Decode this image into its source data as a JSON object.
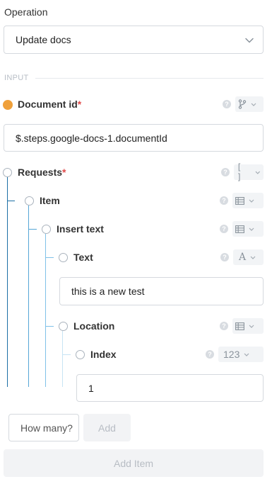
{
  "operation": {
    "label": "Operation",
    "selected": "Update docs"
  },
  "input_section": {
    "label": "INPUT"
  },
  "fields": {
    "document_id": {
      "label": "Document id",
      "required_mark": "*",
      "value": "$.steps.google-docs-1.documentId",
      "type_icon": "branch-icon"
    },
    "requests": {
      "label": "Requests",
      "required_mark": "*",
      "type_icon": "array-icon",
      "type_text": "[ ]"
    },
    "item": {
      "label": "Item",
      "type_icon": "table-icon"
    },
    "insert_text": {
      "label": "Insert text",
      "type_icon": "table-icon"
    },
    "text": {
      "label": "Text",
      "value": "this is a new test",
      "type_icon": "text-icon",
      "type_text": "A"
    },
    "location": {
      "label": "Location",
      "type_icon": "table-icon"
    },
    "index": {
      "label": "Index",
      "value": "1",
      "type_icon": "number-icon",
      "type_text": "123"
    }
  },
  "help_glyph": "?",
  "bottom": {
    "how_many_placeholder": "How many?",
    "add_label": "Add",
    "add_item_label": "Add Item"
  },
  "colors": {
    "required": "#e04b4b",
    "active_dot": "#efa03a",
    "tree_line": "#1d6fa5"
  }
}
